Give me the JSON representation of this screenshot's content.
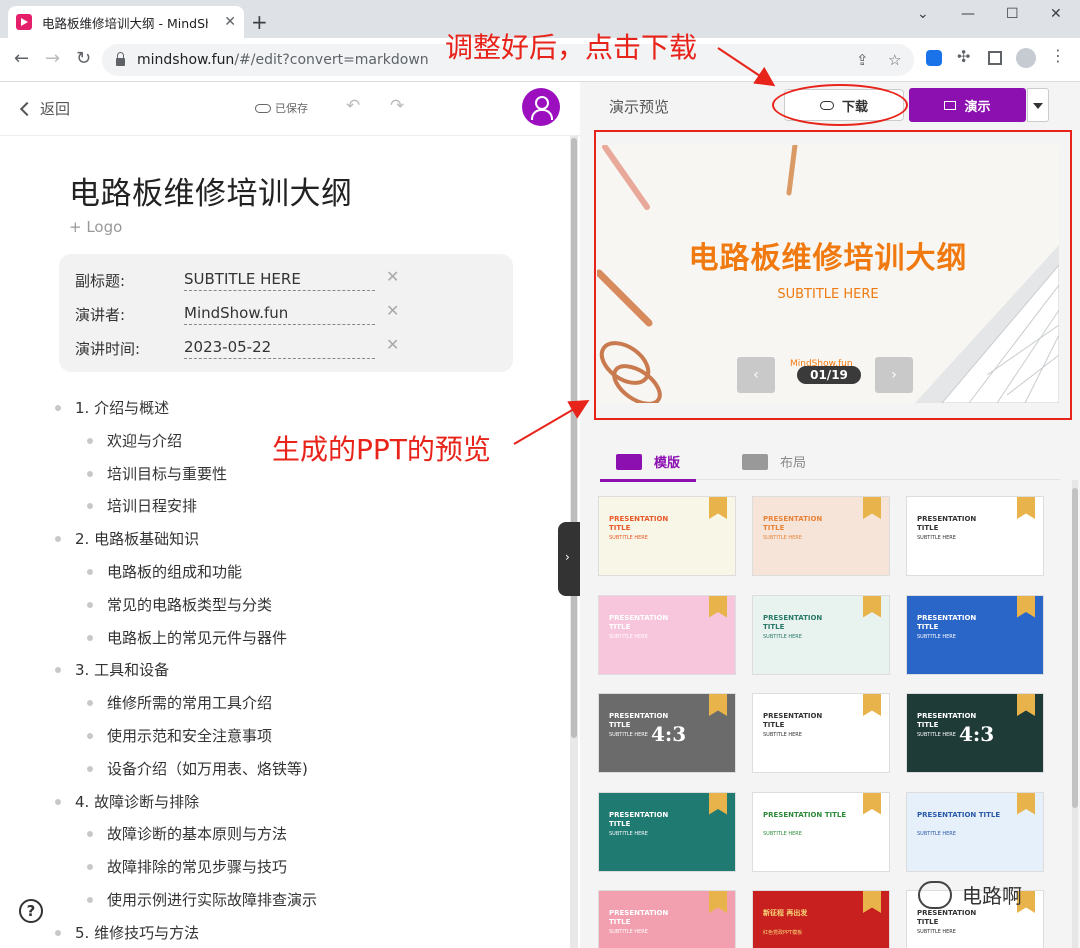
{
  "browser": {
    "tab_title": "电路板维修培训大纲 - MindShow",
    "url_host": "mindshow.fun",
    "url_path": "/#/edit?convert=markdown"
  },
  "editor": {
    "back_label": "返回",
    "saved_label": "已保存",
    "doc_title": "电路板维修培训大纲",
    "logo_link": "+ Logo",
    "meta": [
      {
        "label": "副标题:",
        "value": "SUBTITLE HERE"
      },
      {
        "label": "演讲者:",
        "value": "MindShow.fun"
      },
      {
        "label": "演讲时间:",
        "value": "2023-05-22"
      }
    ],
    "outline": [
      {
        "level": 1,
        "text": "1. 介绍与概述"
      },
      {
        "level": 2,
        "text": "欢迎与介绍"
      },
      {
        "level": 2,
        "text": "培训目标与重要性"
      },
      {
        "level": 2,
        "text": "培训日程安排"
      },
      {
        "level": 1,
        "text": "2. 电路板基础知识"
      },
      {
        "level": 2,
        "text": "电路板的组成和功能"
      },
      {
        "level": 2,
        "text": "常见的电路板类型与分类"
      },
      {
        "level": 2,
        "text": "电路板上的常见元件与器件"
      },
      {
        "level": 1,
        "text": "3. 工具和设备"
      },
      {
        "level": 2,
        "text": "维修所需的常用工具介绍"
      },
      {
        "level": 2,
        "text": "使用示范和安全注意事项"
      },
      {
        "level": 2,
        "text": "设备介绍（如万用表、烙铁等)"
      },
      {
        "level": 1,
        "text": "4. 故障诊断与排除"
      },
      {
        "level": 2,
        "text": "故障诊断的基本原则与方法"
      },
      {
        "level": 2,
        "text": "故障排除的常见步骤与技巧"
      },
      {
        "level": 2,
        "text": "使用示例进行实际故障排查演示"
      },
      {
        "level": 1,
        "text": "5. 维修技巧与方法"
      }
    ],
    "help_label": "?"
  },
  "preview": {
    "panel_label": "演示预览",
    "download_label": "下载",
    "present_label": "演示",
    "slide_title": "电路板维修培训大纲",
    "slide_subtitle": "SUBTITLE HERE",
    "slide_brand": "MindShow.fun",
    "slide_counter": "01/19",
    "prev_icon": "‹",
    "next_icon": "›",
    "tab_templates": "模版",
    "tab_layout": "布局"
  },
  "templates": [
    {
      "title": "PRESENTATION\nTITLE",
      "sub": "SUBTITLE HERE",
      "bg": "#f8f6e6",
      "title_color": "#e85a2a"
    },
    {
      "title": "PRESENTATION\nTITLE",
      "sub": "SUBTITLE HERE",
      "bg": "#f6e4d8",
      "title_color": "#e8833a"
    },
    {
      "title": "PRESENTATION\nTITLE",
      "sub": "SUBTITLE HERE",
      "bg": "#ffffff",
      "title_color": "#333333"
    },
    {
      "title": "PRESENTATION\nTITLE",
      "sub": "SUBTITLE HERE",
      "bg": "#f7c6dc",
      "title_color": "#ffffff"
    },
    {
      "title": "PRESENTATION\nTITLE",
      "sub": "SUBTITLE HERE",
      "bg": "#e8f2ee",
      "title_color": "#2a7a6a"
    },
    {
      "title": "PRESENTATION\nTITLE",
      "sub": "SUBTITLE HERE",
      "bg": "#2a66c8",
      "title_color": "#ffffff"
    },
    {
      "title": "PRESENTATION\nTITLE",
      "sub": "SUBTITLE HERE",
      "bg": "#6b6b6b",
      "title_color": "#ffffff",
      "big": "4:3"
    },
    {
      "title": "PRESENTATION\nTITLE",
      "sub": "SUBTITLE HERE",
      "bg": "#ffffff",
      "title_color": "#333333"
    },
    {
      "title": "PRESENTATION\nTITLE",
      "sub": "SUBTITLE HERE",
      "bg": "#1f3b38",
      "title_color": "#ffffff",
      "big": "4:3"
    },
    {
      "title": "PRESENTATION\nTITLE",
      "sub": "SUBTITLE HERE",
      "bg": "#1f7a72",
      "title_color": "#ffffff"
    },
    {
      "title": "PRESENTATION TITLE",
      "sub": "SUBTITLE HERE",
      "bg": "#ffffff",
      "title_color": "#2e8a3a"
    },
    {
      "title": "PRESENTATION TITLE",
      "sub": "SUBTITLE HERE",
      "bg": "#e6f0fa",
      "title_color": "#2a5aa8"
    },
    {
      "title": "PRESENTATION\nTITLE",
      "sub": "SUBTITLE HERE",
      "bg": "#f2a0b0",
      "title_color": "#ffffff"
    },
    {
      "title": "新征程 再出发",
      "sub": "红色党政PPT模板",
      "bg": "#c8201e",
      "title_color": "#f8d77a"
    },
    {
      "title": "PRESENTATION\nTITLE",
      "sub": "SUBTITLE HERE",
      "bg": "#ffffff",
      "title_color": "#333333"
    }
  ],
  "annotations": {
    "download_note": "调整好后，点击下载",
    "preview_note": "生成的PPT的预览"
  },
  "watermark": "电路啊",
  "colors": {
    "brand": "#8c0fb0",
    "slide_orange": "#f07a10",
    "annotation_red": "#e8231a"
  }
}
